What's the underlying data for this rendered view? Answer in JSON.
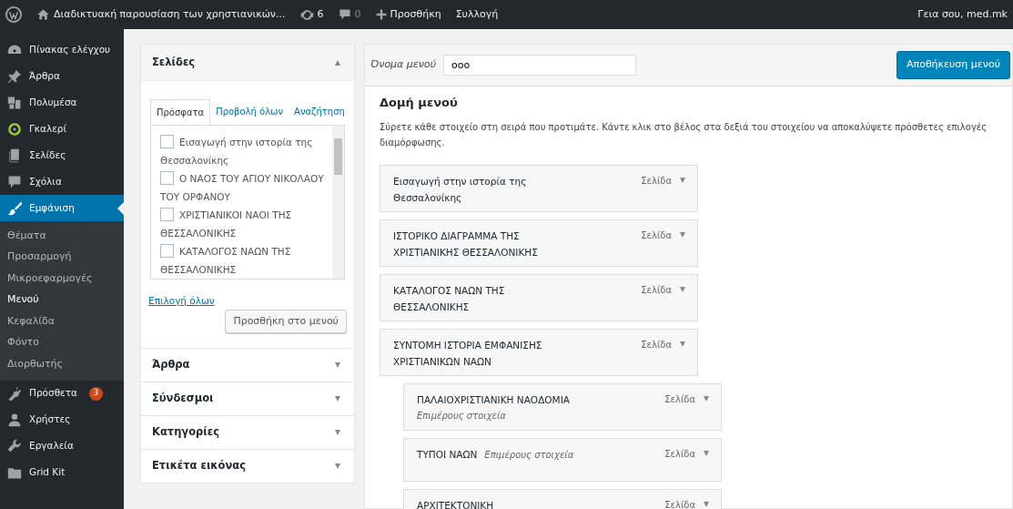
{
  "admin_bar": {
    "site_title": "Διαδικτυακή παρουσίαση των χρηστιανικών...",
    "updates": "6",
    "comments": "0",
    "new": "Προσθήκη",
    "collection": "Συλλογή",
    "greeting": "Γεια σου, med.mk"
  },
  "sidebar": {
    "items": [
      {
        "label": "Πίνακας ελέγχου",
        "selected": false
      },
      {
        "label": "Άρθρα",
        "selected": false
      },
      {
        "label": "Πολυμέσα",
        "selected": false
      },
      {
        "label": "Γκαλερί",
        "selected": false
      },
      {
        "label": "Σελίδες",
        "selected": false
      },
      {
        "label": "Σχόλια",
        "selected": false
      },
      {
        "label": "Εμφάνιση",
        "selected": true,
        "children": [
          {
            "label": "Θέματα",
            "selected": false
          },
          {
            "label": "Προσαρμογή",
            "selected": false
          },
          {
            "label": "Μικροεφαρμογές",
            "selected": false
          },
          {
            "label": "Μενού",
            "selected": true
          },
          {
            "label": "Κεφαλίδα",
            "selected": false
          },
          {
            "label": "Φόντο",
            "selected": false
          },
          {
            "label": "Διορθωτής",
            "selected": false
          }
        ]
      },
      {
        "label": "Πρόσθετα",
        "selected": false,
        "badge": "3"
      },
      {
        "label": "Χρήστες",
        "selected": false
      },
      {
        "label": "Εργαλεία",
        "selected": false
      },
      {
        "label": "Grid Kit",
        "selected": false
      }
    ]
  },
  "add_items": {
    "sections": [
      {
        "title": "Σελίδες",
        "expanded": true,
        "tabs": [
          {
            "label": "Πρόσφατα",
            "selected": true
          },
          {
            "label": "Προβολή όλων",
            "selected": false
          },
          {
            "label": "Αναζήτηση",
            "selected": false
          }
        ],
        "pages": [
          {
            "label": "Εισαγωγή στην ιστορία της Θεσσαλονίκης",
            "checked": false
          },
          {
            "label": "Ο ΝΑΟΣ ΤΟΥ ΑΓΙΟΥ ΝΙΚΟΛΑΟΥ ΤΟΥ ΟΡΦΑΝΟΥ",
            "checked": false
          },
          {
            "label": "ΧΡΙΣΤΙΑΝΙΚΟΙ ΝΑΟΙ ΤΗΣ ΘΕΣΣΑΛΟΝΙΚΗΣ",
            "checked": false
          },
          {
            "label": "ΚΑΤΑΛΟΓΟΣ ΝΑΩΝ ΤΗΣ ΘΕΣΣΑΛΟΝΙΚΗΣ",
            "checked": false
          }
        ],
        "select_all": "Επιλογή όλων",
        "add_button": "Προσθήκη στο μενού"
      },
      {
        "title": "Άρθρα",
        "expanded": false
      },
      {
        "title": "Σύνδεσμοι",
        "expanded": false
      },
      {
        "title": "Κατηγορίες",
        "expanded": false
      },
      {
        "title": "Ετικέτα εικόνας",
        "expanded": false
      }
    ]
  },
  "menu_editor": {
    "name_label": "Όνομα μενού",
    "name_value": "ooo",
    "save_button": "Αποθήκευση μενού",
    "heading": "Δομή μενού",
    "instructions": "Σύρετε κάθε στοιχείο στη σειρά που προτιμάτε. Κάντε κλικ στο βέλος στα δεξιά του στοιχείου να αποκαλύψετε πρόσθετες επιλογές διαμόρφωσης.",
    "items": [
      {
        "title": "Εισαγωγή στην ιστορία της Θεσσαλονίκης",
        "type": "Σελίδα"
      },
      {
        "title": "ΙΣΤΟΡΙΚΟ ΔΙΑΓΡΑΜΜΑ ΤΗΣ ΧΡΙΣΤΙΑΝΙΚΗΣ ΘΕΣΣΑΛΟΝΙΚΗΣ",
        "type": "Σελίδα"
      },
      {
        "title": "ΚΑΤΑΛΟΓΟΣ ΝΑΩΝ ΤΗΣ ΘΕΣΣΑΛΟΝΙΚΗΣ",
        "type": "Σελίδα"
      },
      {
        "title": "ΣΥΝΤΟΜΗ ΙΣΤΟΡΙΑ ΕΜΦΑΝΙΣΗΣ ΧΡΙΣΤΙΑΝΙΚΩΝ ΝΑΩΝ",
        "type": "Σελίδα",
        "children": [
          {
            "title": "ΠΑΛΑΙΟΧΡΙΣΤΙΑΝΙΚΗ ΝΑΟΔΟΜΙΑ",
            "sub_label": "Επιμέρους στοιχεία",
            "type": "Σελίδα"
          },
          {
            "title": "ΤΥΠΟΙ ΝΑΩΝ",
            "sub_label": "Επιμέρους στοιχεία",
            "type": "Σελίδα"
          },
          {
            "title": "ΑΡΧΙΤΕΚΤΟΝΙΚΗ",
            "type": "Σελίδα"
          }
        ]
      }
    ]
  }
}
